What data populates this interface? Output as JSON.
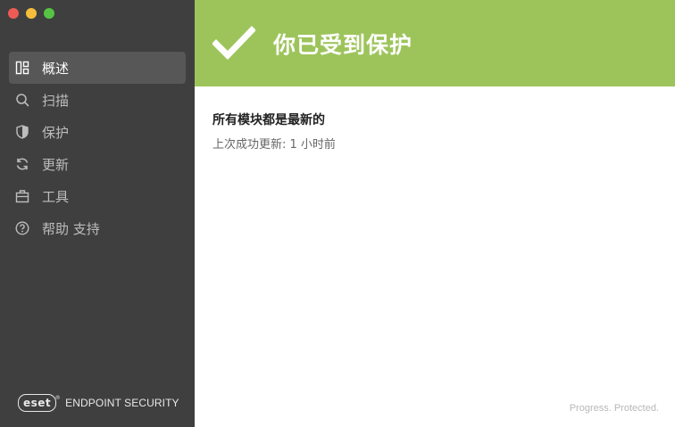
{
  "sidebar": {
    "items": [
      {
        "label": "概述",
        "icon": "overview-icon",
        "active": true
      },
      {
        "label": "扫描",
        "icon": "search-icon",
        "active": false
      },
      {
        "label": "保护",
        "icon": "shield-icon",
        "active": false
      },
      {
        "label": "更新",
        "icon": "refresh-icon",
        "active": false
      },
      {
        "label": "工具",
        "icon": "briefcase-icon",
        "active": false
      },
      {
        "label": "帮助 支持",
        "icon": "help-icon",
        "active": false
      }
    ],
    "brand": {
      "logo": "eset",
      "product": "ENDPOINT SECURITY"
    }
  },
  "banner": {
    "title": "你已受到保护",
    "icon": "checkmark-icon",
    "color": "#9dc45b"
  },
  "status": {
    "title": "所有模块都是最新的",
    "subtitle": "上次成功更新: 1 小时前"
  },
  "footer": {
    "tagline": "Progress. Protected."
  }
}
